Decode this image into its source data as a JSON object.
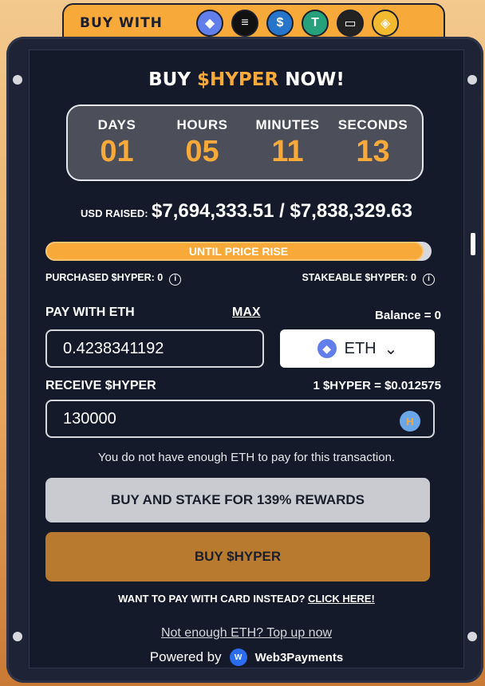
{
  "header": {
    "buy_with_label": "BUY WITH",
    "coins": [
      {
        "name": "eth-coin-icon",
        "glyph": "◆",
        "color": "#627eea"
      },
      {
        "name": "sol-coin-icon",
        "glyph": "≡",
        "color": "#111111"
      },
      {
        "name": "usdc-coin-icon",
        "glyph": "$",
        "color": "#2775ca"
      },
      {
        "name": "usdt-coin-icon",
        "glyph": "T",
        "color": "#26a17b"
      },
      {
        "name": "card-icon",
        "glyph": "▭",
        "color": "#222222"
      },
      {
        "name": "bnb-coin-icon",
        "glyph": "◈",
        "color": "#f3ba2f"
      }
    ]
  },
  "widget": {
    "title_prefix": "BUY ",
    "title_accent": "$HYPER",
    "title_suffix": " NOW!",
    "timer": {
      "days_label": "DAYS",
      "days": "01",
      "hours_label": "HOURS",
      "hours": "05",
      "minutes_label": "MINUTES",
      "minutes": "11",
      "seconds_label": "SECONDS",
      "seconds": "13"
    },
    "raised_label": "USD RAISED:",
    "raised_amount": "$7,694,333.51 / $7,838,329.63",
    "progress_label": "UNTIL PRICE RISE",
    "progress_fraction": 0.98,
    "purchased_label": "PURCHASED $HYPER: 0",
    "stakeable_label": "STAKEABLE $HYPER: 0",
    "pay_label": "PAY WITH ETH",
    "max_label": "MAX",
    "balance_label": "Balance = 0",
    "pay_value": "0.4238341192",
    "currency": "ETH",
    "receive_label": "RECEIVE $HYPER",
    "rate_label": "1 $HYPER = $0.012575",
    "receive_value": "130000",
    "warning": "You do not have enough ETH to pay for this transaction.",
    "stake_button": "BUY AND STAKE FOR 139% REWARDS",
    "buy_button": "BUY $HYPER",
    "card_prompt": "WANT TO PAY WITH CARD INSTEAD? ",
    "card_link": "CLICK HERE!",
    "topup_link": "Not enough ETH? Top up now",
    "powered_by": "Powered by",
    "powered_brand": "Web3Payments"
  },
  "colors": {
    "accent": "#f7a93a",
    "panel": "#141a29",
    "buy_button": "#b87a2e"
  }
}
